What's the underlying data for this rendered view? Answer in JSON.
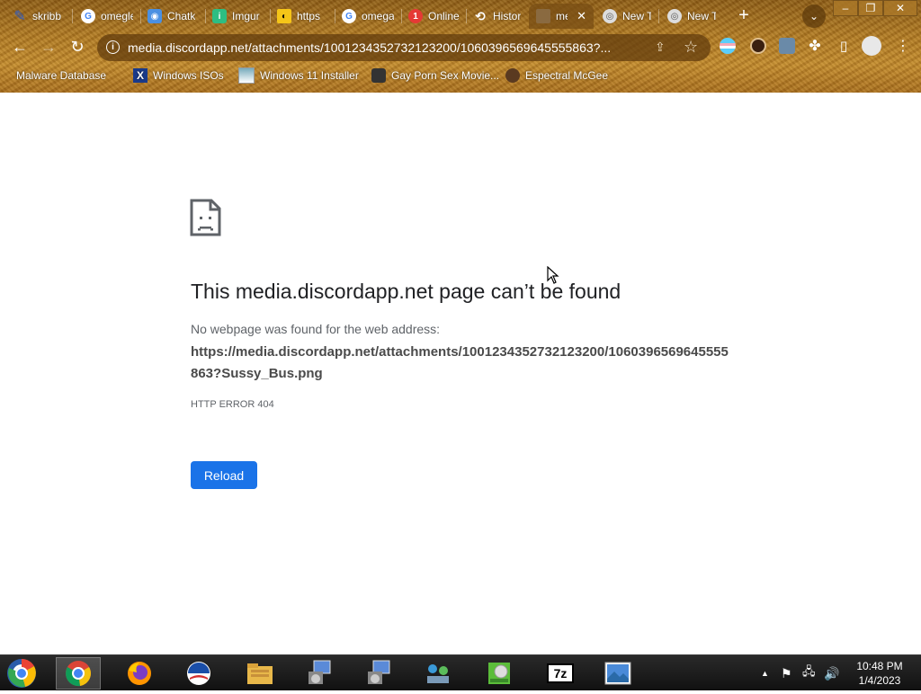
{
  "browser": {
    "tabs": [
      {
        "title": "skribb",
        "icon": "skribbl-icon",
        "color": "#2b59c3"
      },
      {
        "title": "omegle",
        "icon": "google-icon",
        "color": "#ffffff"
      },
      {
        "title": "Chatk",
        "icon": "chatkit-icon",
        "color": "#4a90e2"
      },
      {
        "title": "Imgur",
        "icon": "imgur-icon",
        "color": "#2dbe82"
      },
      {
        "title": "https",
        "icon": "glasses-icon",
        "color": "#f5c518"
      },
      {
        "title": "omega",
        "icon": "google-icon",
        "color": "#ffffff"
      },
      {
        "title": "Online",
        "icon": "alert-icon",
        "color": "#e53935"
      },
      {
        "title": "Histor",
        "icon": "history-icon",
        "color": "#ffffff"
      },
      {
        "title": "me",
        "icon": "image-icon",
        "color": "#8a6a40",
        "active": true
      },
      {
        "title": "New T",
        "icon": "chrome-icon",
        "color": "#ffffff"
      },
      {
        "title": "New T",
        "icon": "chrome-icon",
        "color": "#ffffff"
      }
    ],
    "url": "media.discordapp.net/attachments/1001234352732123200/1060396569645555863?...",
    "bookmarks": [
      {
        "label": "Malware Database",
        "icon": "folder-icon"
      },
      {
        "label": "Windows ISOs",
        "icon": "x-logo-icon"
      },
      {
        "label": "Windows 11 Installer",
        "icon": "image-icon"
      },
      {
        "label": "Gay Porn Sex Movie...",
        "icon": "avatar-icon"
      },
      {
        "label": "Espectral McGee",
        "icon": "avatar-icon"
      }
    ]
  },
  "page": {
    "title": "This media.discordapp.net page can’t be found",
    "description": "No webpage was found for the web address:",
    "full_url": "https://media.discordapp.net/attachments/1001234352732123200/1060396569645555863?Sussy_Bus.png",
    "error_code": "HTTP ERROR 404",
    "reload_label": "Reload"
  },
  "taskbar": {
    "apps": [
      "chrome-icon",
      "firefox-icon",
      "obama-icon",
      "file-explorer-icon",
      "installer-icon",
      "installer-icon",
      "network-icon",
      "disk-icon",
      "7zip-icon",
      "photo-viewer-icon"
    ],
    "sevenzip_label": "7z",
    "time": "10:48 PM",
    "date": "1/4/2023"
  },
  "colors": {
    "accent": "#1a73e8",
    "title_text": "#202124",
    "body_text": "#5f6368"
  }
}
